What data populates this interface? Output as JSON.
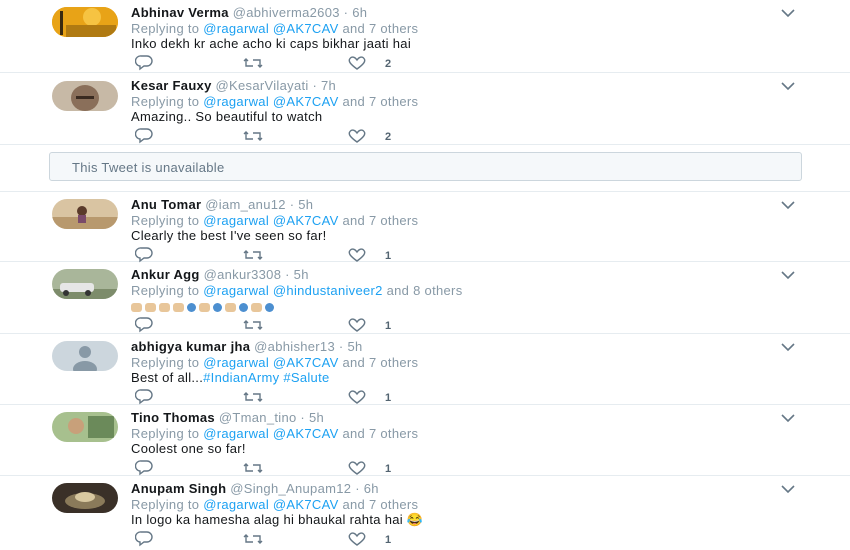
{
  "tweets": [
    {
      "name": "Abhinav Verma",
      "handle": "@abhiverma2603 · 6h",
      "replying_prefix": "Replying to ",
      "mentions": "@ragarwal @AK7CAV",
      "replying_suffix": " and 7 others",
      "text": "Inko dekh kr ache acho ki caps bikhar jaati hai",
      "likes": "2",
      "avatar_color": "#e8a317"
    },
    {
      "name": "Kesar Fauxy",
      "handle": "@KesarVilayati · 7h",
      "replying_prefix": "Replying to ",
      "mentions": "@ragarwal @AK7CAV",
      "replying_suffix": " and 7 others",
      "text": "Amazing.. So beautiful to watch",
      "likes": "2",
      "avatar_color": "#8a6f5a"
    },
    {
      "name": "Anu Tomar",
      "handle": "@iam_anu12 · 5h",
      "replying_prefix": "Replying to ",
      "mentions": "@ragarwal @AK7CAV",
      "replying_suffix": " and 7 others",
      "text": "Clearly the best I've seen so far!",
      "likes": "1",
      "avatar_color": "#c9a77c"
    },
    {
      "name": "Ankur Agg",
      "handle": "@ankur3308 · 5h",
      "replying_prefix": "Replying to ",
      "mentions": "@ragarwal @hindustaniveer2",
      "replying_suffix": " and 8 others",
      "text": "",
      "likes": "1",
      "avatar_color": "#7d8c6b"
    },
    {
      "name": "abhigya kumar jha",
      "handle": "@abhisher13 · 5h",
      "replying_prefix": "Replying to ",
      "mentions": "@ragarwal @AK7CAV",
      "replying_suffix": " and 7 others",
      "text_prefix": "Best of all...",
      "text_tags": "#IndianArmy #Salute",
      "likes": "1",
      "avatar_color": "#ccd6dd"
    },
    {
      "name": "Tino Thomas",
      "handle": "@Tman_tino · 5h",
      "replying_prefix": "Replying to ",
      "mentions": "@ragarwal @AK7CAV",
      "replying_suffix": " and 7 others",
      "text": "Coolest one so far!",
      "likes": "1",
      "avatar_color": "#6b8a5a"
    },
    {
      "name": "Anupam Singh",
      "handle": "@Singh_Anupam12 · 6h",
      "replying_prefix": "Replying to ",
      "mentions": "@ragarwal @AK7CAV",
      "replying_suffix": " and 7 others",
      "text": "In logo ka hamesha alag hi bhaukal rahta hai 😂",
      "likes": "1",
      "avatar_color": "#5a4a3a"
    }
  ],
  "unavailable_notice": "This Tweet is unavailable",
  "colors": {
    "link": "#1da1f2",
    "muted": "#8899a6",
    "text": "#14171a",
    "border": "#e6ecf0"
  },
  "icons": [
    "reply-icon",
    "retweet-icon",
    "like-icon",
    "chevron-down-icon"
  ]
}
